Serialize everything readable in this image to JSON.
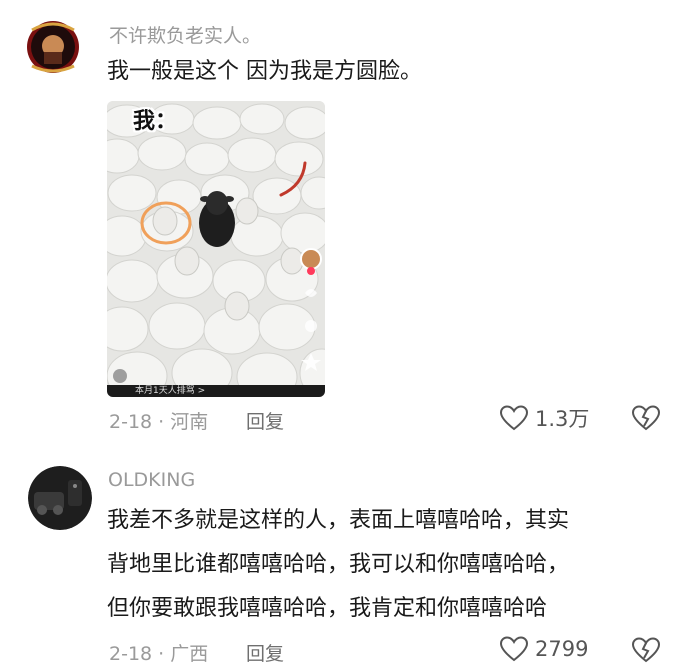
{
  "comments": [
    {
      "username": "不许欺负老实人。",
      "text_lines": [
        "我一般是这个 因为我是方圆脸。"
      ],
      "image": {
        "label": "我：",
        "watermark_text": "本月1天人排骂 >"
      },
      "date_location": "2-18 · 河南",
      "reply_label": "回复",
      "like_count": "1.3万"
    },
    {
      "username": "OLDKING",
      "text_lines": [
        "我差不多就是这样的人，表面上嘻嘻哈哈，其实",
        "背地里比谁都嘻嘻哈哈，我可以和你嘻嘻哈哈，",
        "但你要敢跟我嘻嘻哈哈，我肯定和你嘻嘻哈哈"
      ],
      "date_location": "2-18 · 广西",
      "reply_label": "回复",
      "like_count": "2799"
    }
  ],
  "colors": {
    "meta": "#9a9a9a",
    "text": "#1a1a1a",
    "accent_circle": "#f0a05a",
    "accent_mark": "#c0392b"
  },
  "icons": [
    "heart-outline-icon",
    "broken-heart-icon",
    "avatar-image"
  ]
}
